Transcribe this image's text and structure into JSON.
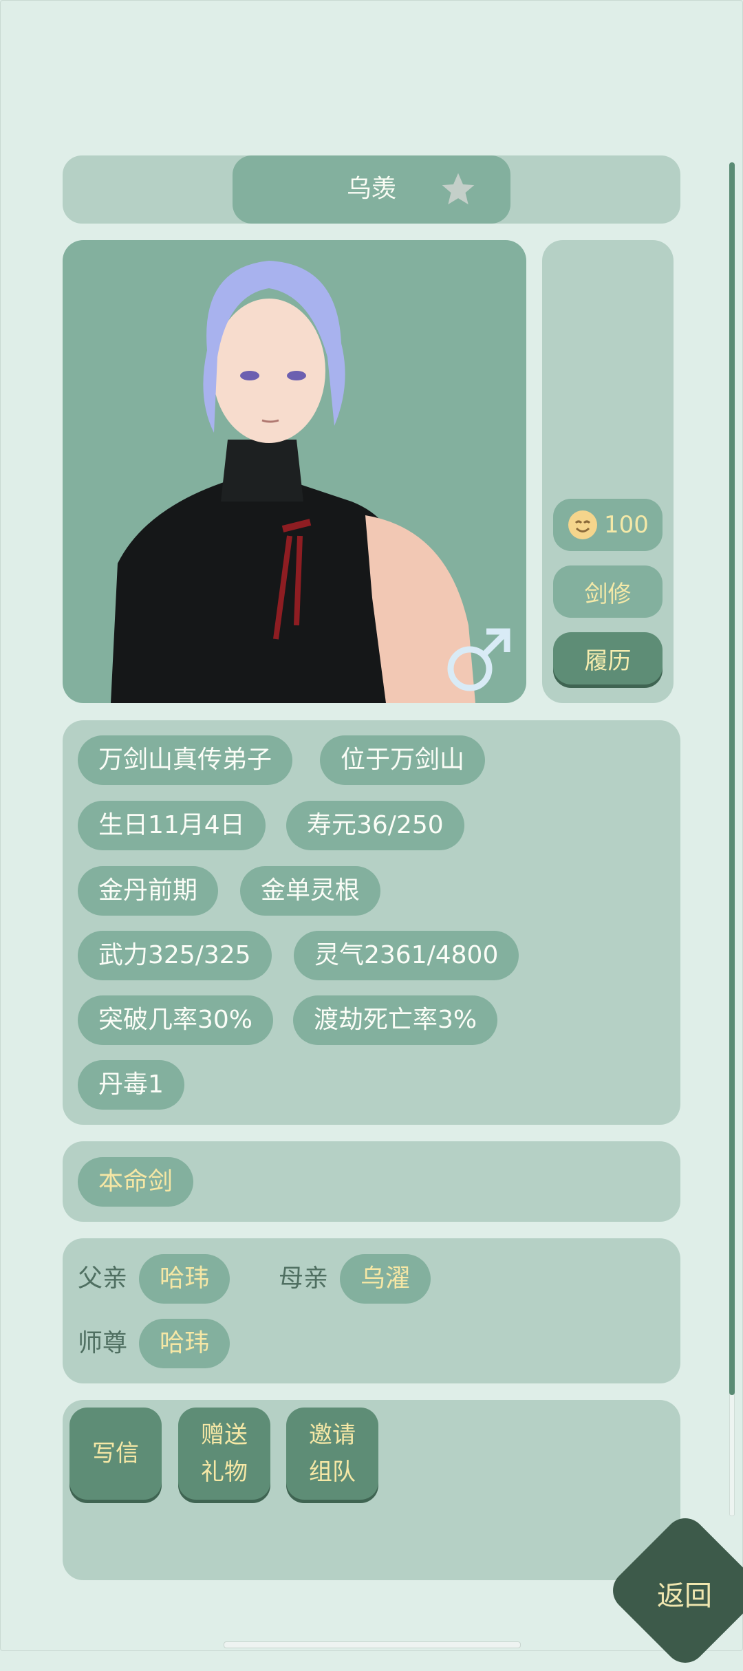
{
  "character": {
    "name": "乌羡",
    "favorite_icon": "star-icon",
    "gender_icon": "male-symbol-icon"
  },
  "side": {
    "mood_icon": "smiley-face-icon",
    "mood_value": "100",
    "class_label": "剑修",
    "resume_label": "履历"
  },
  "info_tags": [
    "万剑山真传弟子",
    "位于万剑山",
    "生日11月4日",
    "寿元36/250",
    "金丹前期",
    "金单灵根",
    "武力325/325",
    "灵气2361/4800",
    "突破几率30%",
    "渡劫死亡率3%",
    "丹毒1"
  ],
  "weapon": {
    "label": "本命剑"
  },
  "relations": {
    "father_label": "父亲",
    "father_name": "哈玮",
    "mother_label": "母亲",
    "mother_name": "乌濯",
    "master_label": "师尊",
    "master_name": "哈玮"
  },
  "actions": {
    "write_letter": "写信",
    "gift_line1": "赠送",
    "gift_line2": "礼物",
    "invite_line1": "邀请",
    "invite_line2": "组队"
  },
  "back_label": "返回",
  "colors": {
    "background": "#dfeee8",
    "panel": "#b5d0c5",
    "pill": "#83b09e",
    "button_dark": "#5e8d76",
    "gold_text": "#f6e7a5",
    "back_button": "#3d5a4a"
  }
}
